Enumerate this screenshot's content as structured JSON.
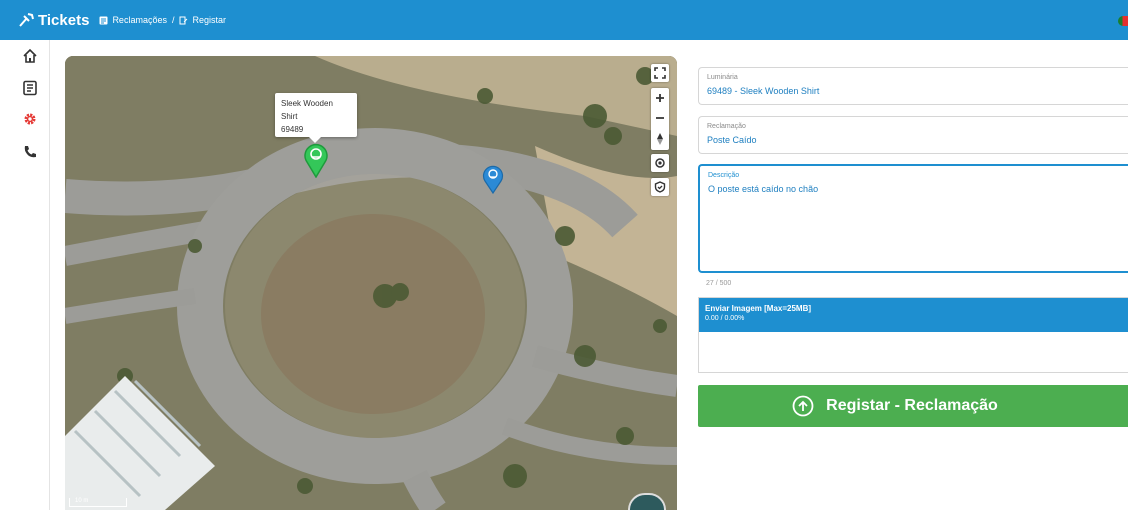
{
  "header": {
    "app_title": "Tickets",
    "breadcrumb": [
      {
        "label": "Reclamações",
        "icon": "list-icon"
      },
      {
        "label": "Registar",
        "icon": "document-edit-icon"
      }
    ],
    "separator": "/",
    "flag": "portugal-flag"
  },
  "sidebar": {
    "items": [
      {
        "icon": "home-icon"
      },
      {
        "icon": "list-icon"
      },
      {
        "icon": "gear-icon",
        "color": "#e53935"
      },
      {
        "icon": "phone-icon"
      }
    ]
  },
  "map": {
    "popup": {
      "name": "Sleek Wooden Shirt",
      "id": "69489"
    },
    "scale": "10 m",
    "controls": [
      "fullscreen-icon",
      "zoom-in-icon",
      "zoom-out-icon",
      "north-arrow-icon",
      "locate-icon",
      "shield-icon"
    ]
  },
  "form": {
    "luminaria": {
      "label": "Luminária",
      "value": "69489 - Sleek Wooden Shirt"
    },
    "reclamacao": {
      "label": "Reclamação",
      "value": "Poste Caído"
    },
    "descricao": {
      "label": "Descrição",
      "value": "O poste está caído no chão"
    },
    "char_count": "27 / 500",
    "upload": {
      "title": "Enviar Imagem [Max=25MB]",
      "progress": "0.00 / 0.00%"
    },
    "submit_label": "Registar - Reclamação"
  },
  "colors": {
    "primary": "#1e8fd0",
    "success": "#4cae50",
    "accent_red": "#e53935"
  }
}
